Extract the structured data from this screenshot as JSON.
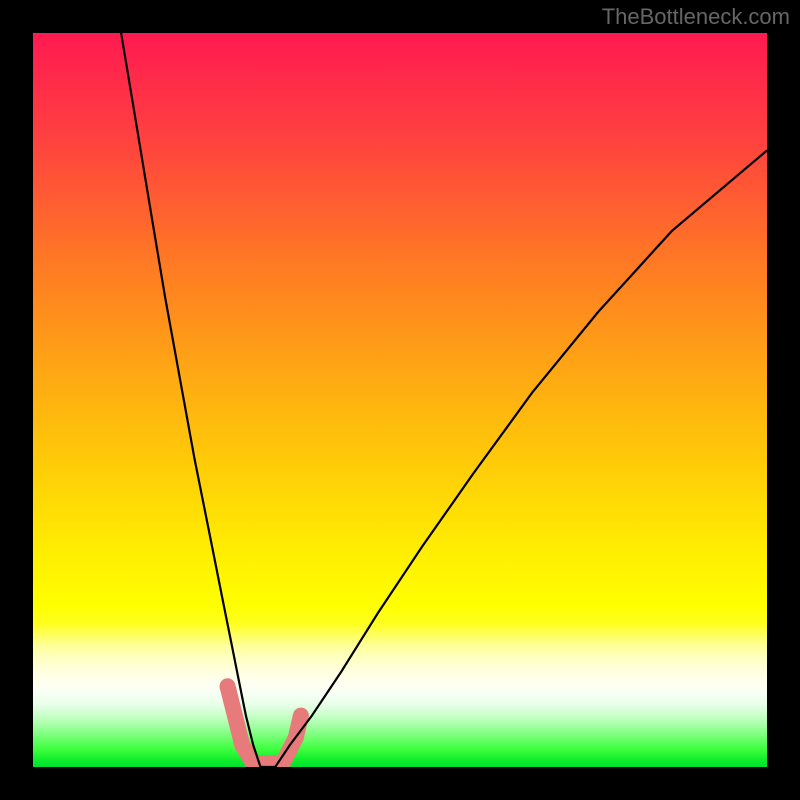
{
  "watermark": "TheBottleneck.com",
  "chart_data": {
    "type": "line",
    "title": "",
    "xlabel": "",
    "ylabel": "",
    "xlim": [
      0,
      100
    ],
    "ylim": [
      0,
      100
    ],
    "grid": false,
    "legend": false,
    "background": "rainbow-gradient-red-to-green-vertical",
    "series": [
      {
        "name": "bottleneck-curve",
        "x": [
          12,
          14,
          16,
          18,
          20,
          22,
          24,
          26,
          27,
          28,
          29,
          30,
          31,
          33,
          35,
          38,
          42,
          47,
          53,
          60,
          68,
          77,
          87,
          100
        ],
        "y": [
          100,
          88,
          76,
          64,
          53,
          42,
          32,
          22,
          17,
          12,
          7,
          3,
          0,
          0,
          3,
          7,
          13,
          21,
          30,
          40,
          51,
          62,
          73,
          84
        ]
      }
    ],
    "markers": {
      "name": "highlight-range",
      "points": [
        {
          "x": 26.5,
          "y": 11
        },
        {
          "x": 27.5,
          "y": 7
        },
        {
          "x": 28.5,
          "y": 3
        },
        {
          "x": 30.0,
          "y": 0.5
        },
        {
          "x": 32.0,
          "y": 0.5
        },
        {
          "x": 34.0,
          "y": 0.5
        },
        {
          "x": 35.8,
          "y": 4
        },
        {
          "x": 36.5,
          "y": 7
        }
      ],
      "color": "#e77a7a"
    },
    "minimum_at_x": 31
  }
}
